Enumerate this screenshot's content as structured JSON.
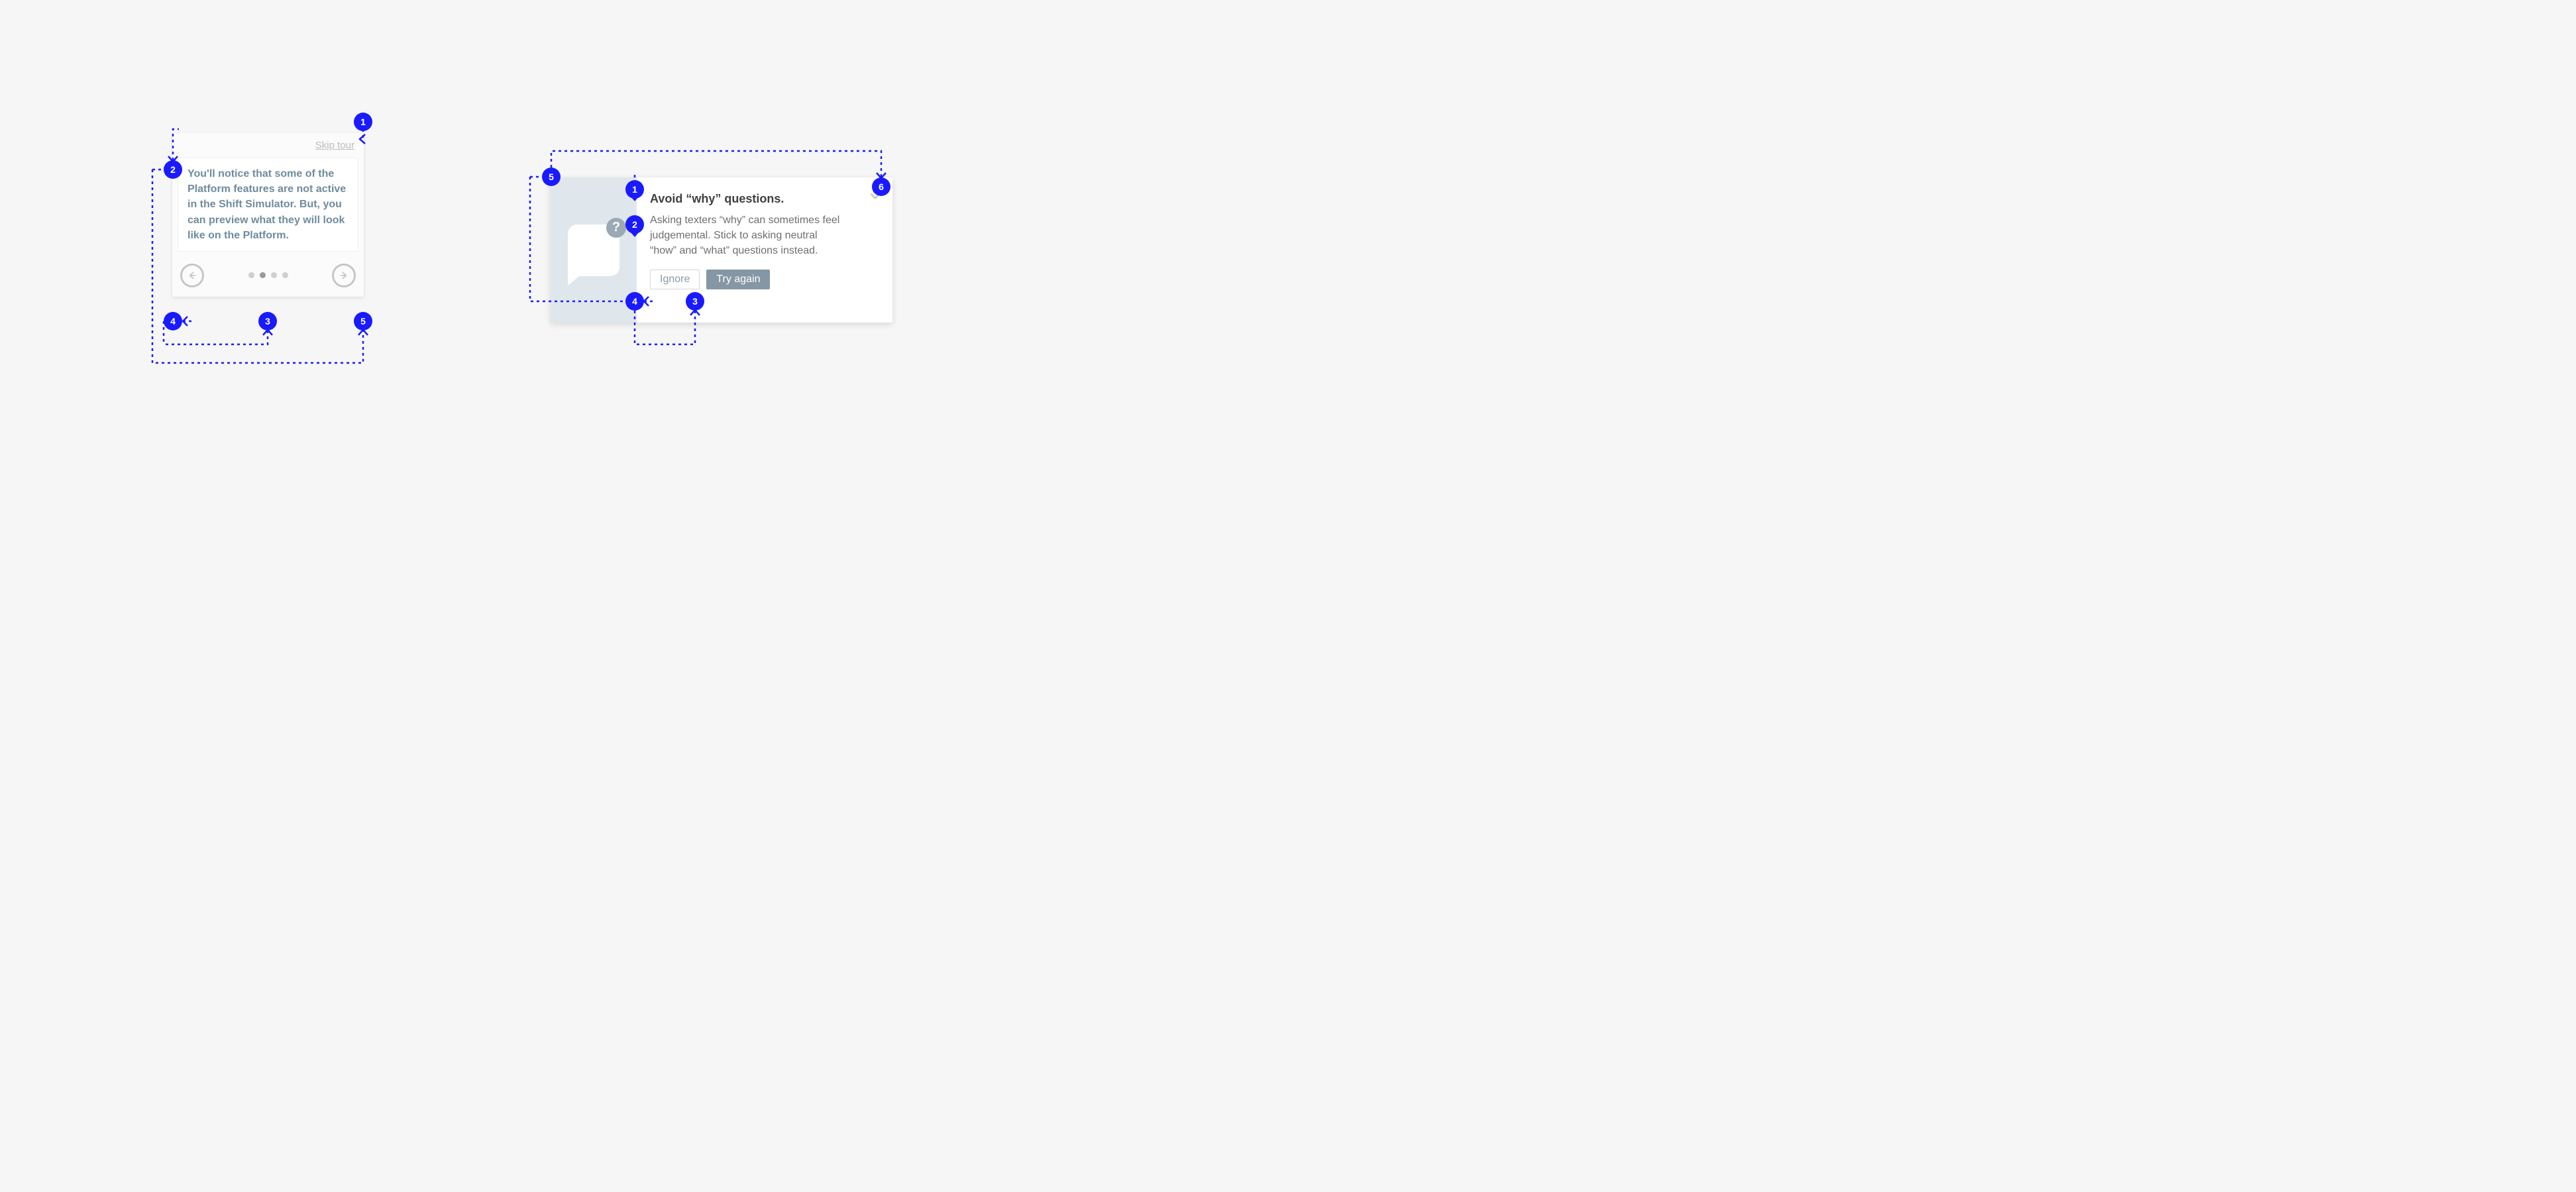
{
  "tour": {
    "skip_label": "Skip tour",
    "body": "You'll notice that some of the Platform features are not active in the Shift Simulator. But, you can preview what they will look like on the Platform.",
    "dots": {
      "count": 4,
      "active_index": 1
    },
    "annotations": [
      "1",
      "2",
      "3",
      "4",
      "5"
    ]
  },
  "tip": {
    "title": "Avoid “why” questions.",
    "body": "Asking texters “why” can sometimes feel judgemental. Stick to asking neutral “how” and “what” questions instead.",
    "ignore_label": "Ignore",
    "try_label": "Try again",
    "icon_glyph": "?",
    "annotations": [
      "1",
      "2",
      "3",
      "4",
      "5",
      "6"
    ]
  },
  "colors": {
    "annotation_blue": "#1a1aff",
    "tour_text": "#6f8b9e",
    "tip_button_primary": "#8597a4"
  }
}
